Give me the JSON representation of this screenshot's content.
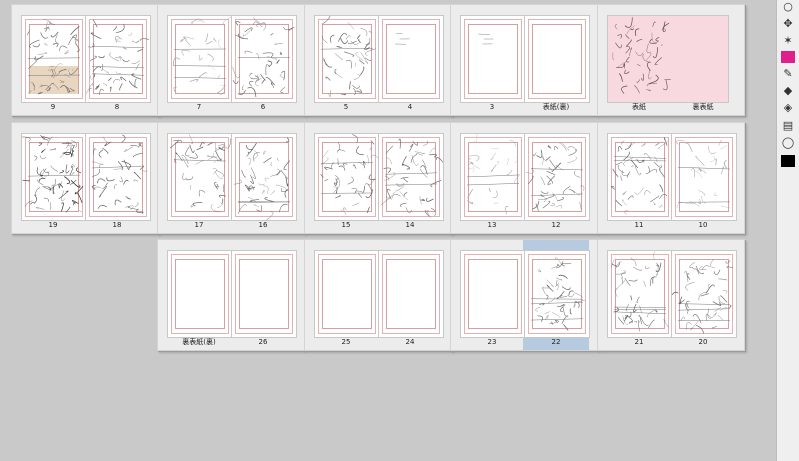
{
  "rows": [
    {
      "spreads": [
        {
          "left_label": "9",
          "right_label": "8",
          "left_content": "photo",
          "right_content": "sketch"
        },
        {
          "left_label": "7",
          "right_label": "6",
          "left_content": "sketch-light",
          "right_content": "sketch"
        },
        {
          "left_label": "5",
          "right_label": "4",
          "left_content": "sketch",
          "right_content": "blank-note"
        },
        {
          "left_label": "3",
          "right_label": "表紙(裏)",
          "left_content": "blank-note",
          "right_content": "blank"
        },
        {
          "cover": true,
          "left_label": "表紙",
          "right_label": "裏表紙",
          "left_content": "cover",
          "right_content": "cover"
        }
      ]
    },
    {
      "spreads": [
        {
          "left_label": "19",
          "right_label": "18",
          "left_content": "sketch-dark",
          "right_content": "sketch"
        },
        {
          "left_label": "17",
          "right_label": "16",
          "left_content": "sketch",
          "right_content": "sketch"
        },
        {
          "left_label": "15",
          "right_label": "14",
          "left_content": "sketch",
          "right_content": "sketch"
        },
        {
          "left_label": "13",
          "right_label": "12",
          "left_content": "sketch-light",
          "right_content": "sketch"
        },
        {
          "left_label": "11",
          "right_label": "10",
          "left_content": "sketch",
          "right_content": "sketch-light"
        }
      ]
    },
    {
      "spreads": [
        {
          "left_label": "裏表紙(裏)",
          "right_label": "26",
          "left_content": "blank",
          "right_content": "blank"
        },
        {
          "left_label": "25",
          "right_label": "24",
          "left_content": "blank",
          "right_content": "blank"
        },
        {
          "left_label": "23",
          "right_label": "22",
          "left_content": "blank",
          "right_content": "sketch",
          "selected": "right"
        },
        {
          "left_label": "21",
          "right_label": "20",
          "left_content": "sketch",
          "right_content": "sketch"
        }
      ]
    }
  ],
  "tools": [
    {
      "icon": "○",
      "name": "lasso-select-icon"
    },
    {
      "icon": "✥",
      "name": "move-icon"
    },
    {
      "icon": "✶",
      "name": "magic-wand-icon"
    },
    {
      "icon": "",
      "name": "color-swatch-pink",
      "color": "#e0208a"
    },
    {
      "icon": "✎",
      "name": "pen-icon"
    },
    {
      "icon": "◆",
      "name": "eraser-icon"
    },
    {
      "icon": "◈",
      "name": "fill-icon"
    },
    {
      "icon": "▤",
      "name": "frame-icon"
    },
    {
      "icon": "◯",
      "name": "balloon-icon"
    },
    {
      "icon": "",
      "name": "color-swatch-black",
      "color": "#000000"
    }
  ],
  "colors": {
    "background": "#c9c9c9",
    "selection": "#b7cbe0",
    "cover_tint": "#f8d9df"
  }
}
